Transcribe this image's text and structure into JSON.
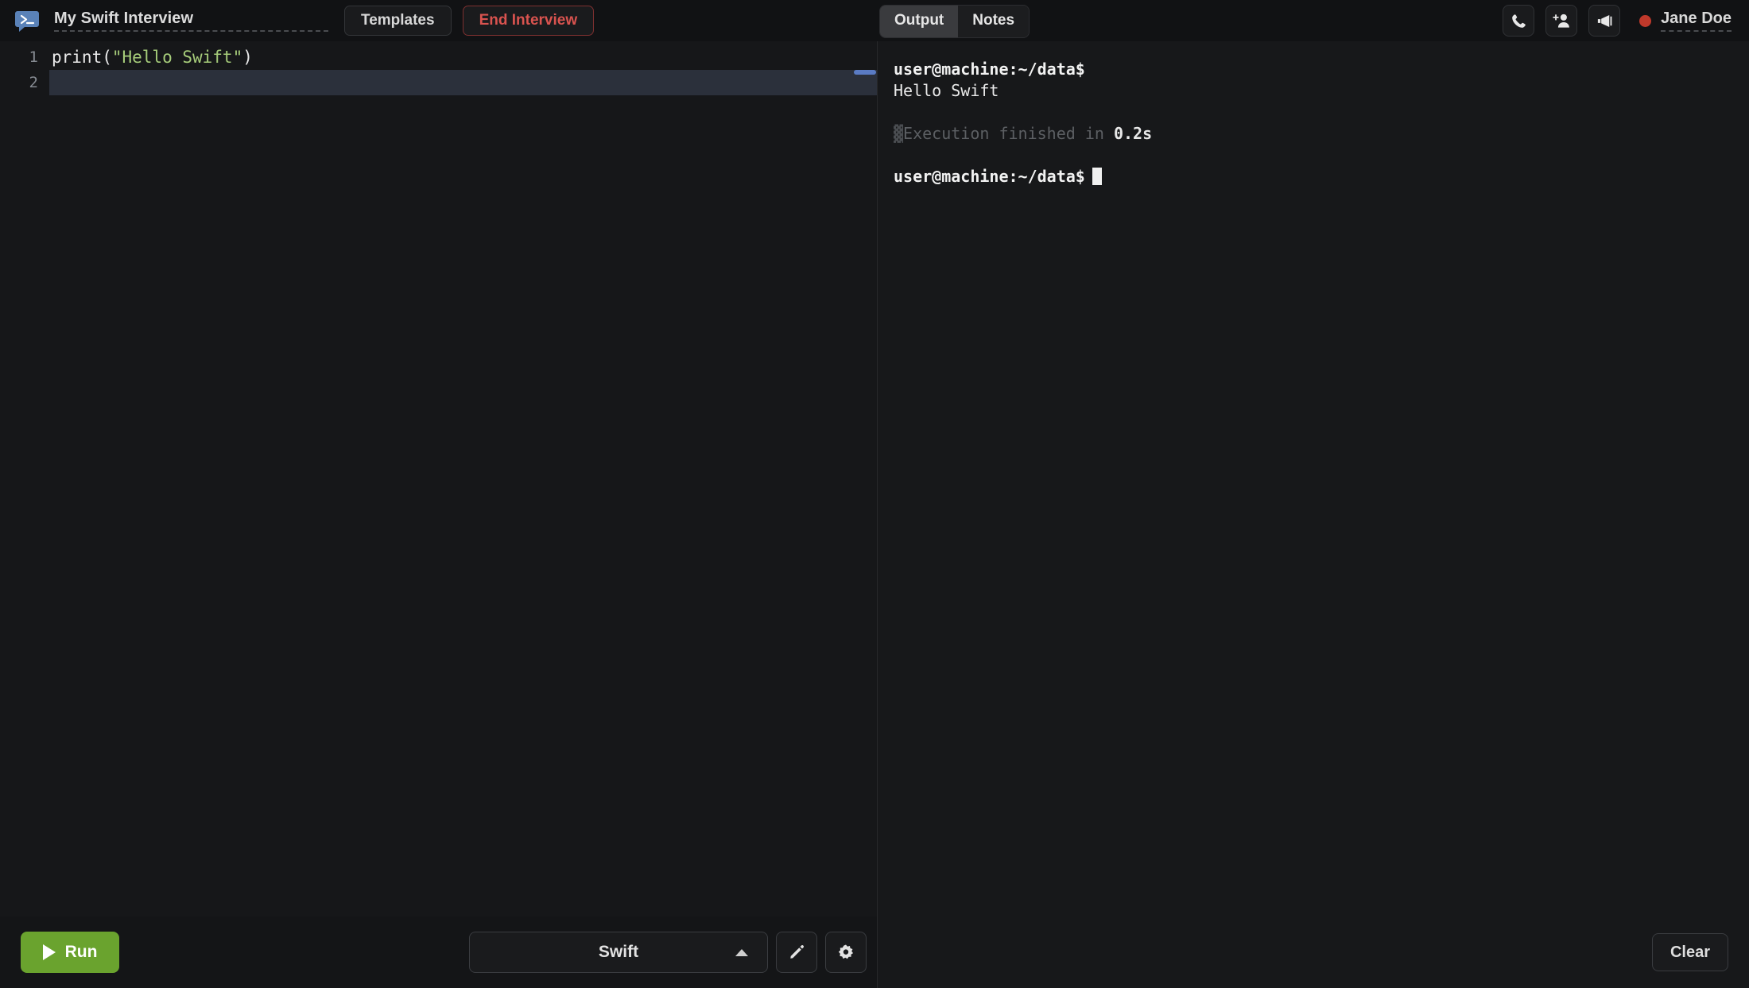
{
  "header": {
    "logo_icon": "terminal-bubble-icon",
    "session_title": "My Swift Interview",
    "templates_label": "Templates",
    "end_interview_label": "End Interview",
    "tabs": [
      {
        "label": "Output",
        "active": true
      },
      {
        "label": "Notes",
        "active": false
      }
    ],
    "actions": [
      {
        "icon": "phone-icon"
      },
      {
        "icon": "add-person-icon"
      },
      {
        "icon": "megaphone-icon"
      }
    ],
    "user": {
      "name": "Jane Doe",
      "status_color": "#c0392b"
    }
  },
  "editor": {
    "lines": [
      {
        "number": "1",
        "active": false,
        "tokens": [
          {
            "text": "print(",
            "type": "plain"
          },
          {
            "text": "\"Hello Swift\"",
            "type": "string"
          },
          {
            "text": ")",
            "type": "plain"
          }
        ]
      },
      {
        "number": "2",
        "active": true,
        "tokens": []
      }
    ],
    "string_color": "#a6cc7a",
    "plain_color": "#eaeaea",
    "active_line_color": "#2b303b",
    "scrollbar_color": "#5a7bc4"
  },
  "editor_footer": {
    "run_label": "Run",
    "run_color": "#6aa32e",
    "language": "Swift",
    "chevron_icon": "chevron-up-icon",
    "edit_icon": "pencil-icon",
    "settings_icon": "gear-icon"
  },
  "terminal": {
    "lines": [
      {
        "type": "prompt",
        "text": "user@machine:~/data$"
      },
      {
        "type": "output",
        "text": "Hello Swift"
      },
      {
        "type": "spacer",
        "text": ""
      },
      {
        "type": "status",
        "glyph": "▓",
        "prefix": "Execution finished in ",
        "value": "0.2s"
      },
      {
        "type": "spacer",
        "text": ""
      },
      {
        "type": "prompt-cursor",
        "text": "user@machine:~/data$"
      }
    ]
  },
  "output_footer": {
    "clear_label": "Clear"
  }
}
